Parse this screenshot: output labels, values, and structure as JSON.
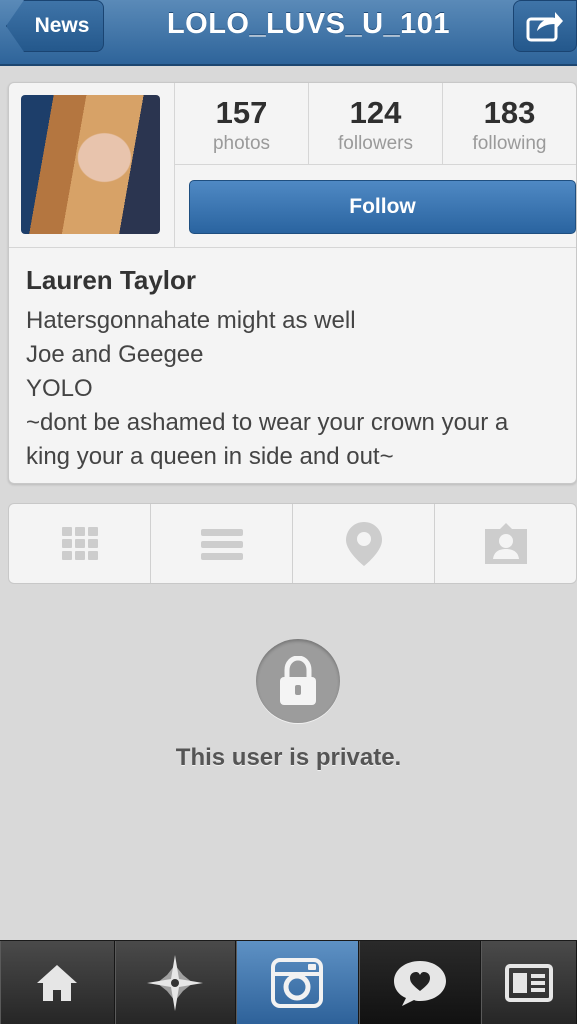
{
  "navbar": {
    "back_label": "News",
    "title": "LOLO_LUVS_U_101",
    "share_icon": "share-icon"
  },
  "profile": {
    "stats": [
      {
        "value": "157",
        "label": "photos"
      },
      {
        "value": "124",
        "label": "followers"
      },
      {
        "value": "183",
        "label": "following"
      }
    ],
    "follow_label": "Follow",
    "name": "Lauren Taylor",
    "bio_lines": [
      "Hatersgonnahate might as well",
      "Joe and Geegee",
      "YOLO",
      "~dont be ashamed to wear your crown your a",
      "king your a queen in side and out~"
    ]
  },
  "view_tabs": [
    "grid-icon",
    "list-icon",
    "location-pin-icon",
    "tagged-person-icon"
  ],
  "private": {
    "message": "This user is private.",
    "icon": "lock-icon"
  },
  "bottom_bar": {
    "items": [
      "home-icon",
      "explore-icon",
      "camera-icon",
      "activity-heart-icon",
      "profile-card-icon"
    ],
    "active": "camera-icon"
  },
  "colors": {
    "navbar_blue": "#2e649a",
    "follow_blue": "#2a64a0",
    "background": "#d9d9d9"
  }
}
